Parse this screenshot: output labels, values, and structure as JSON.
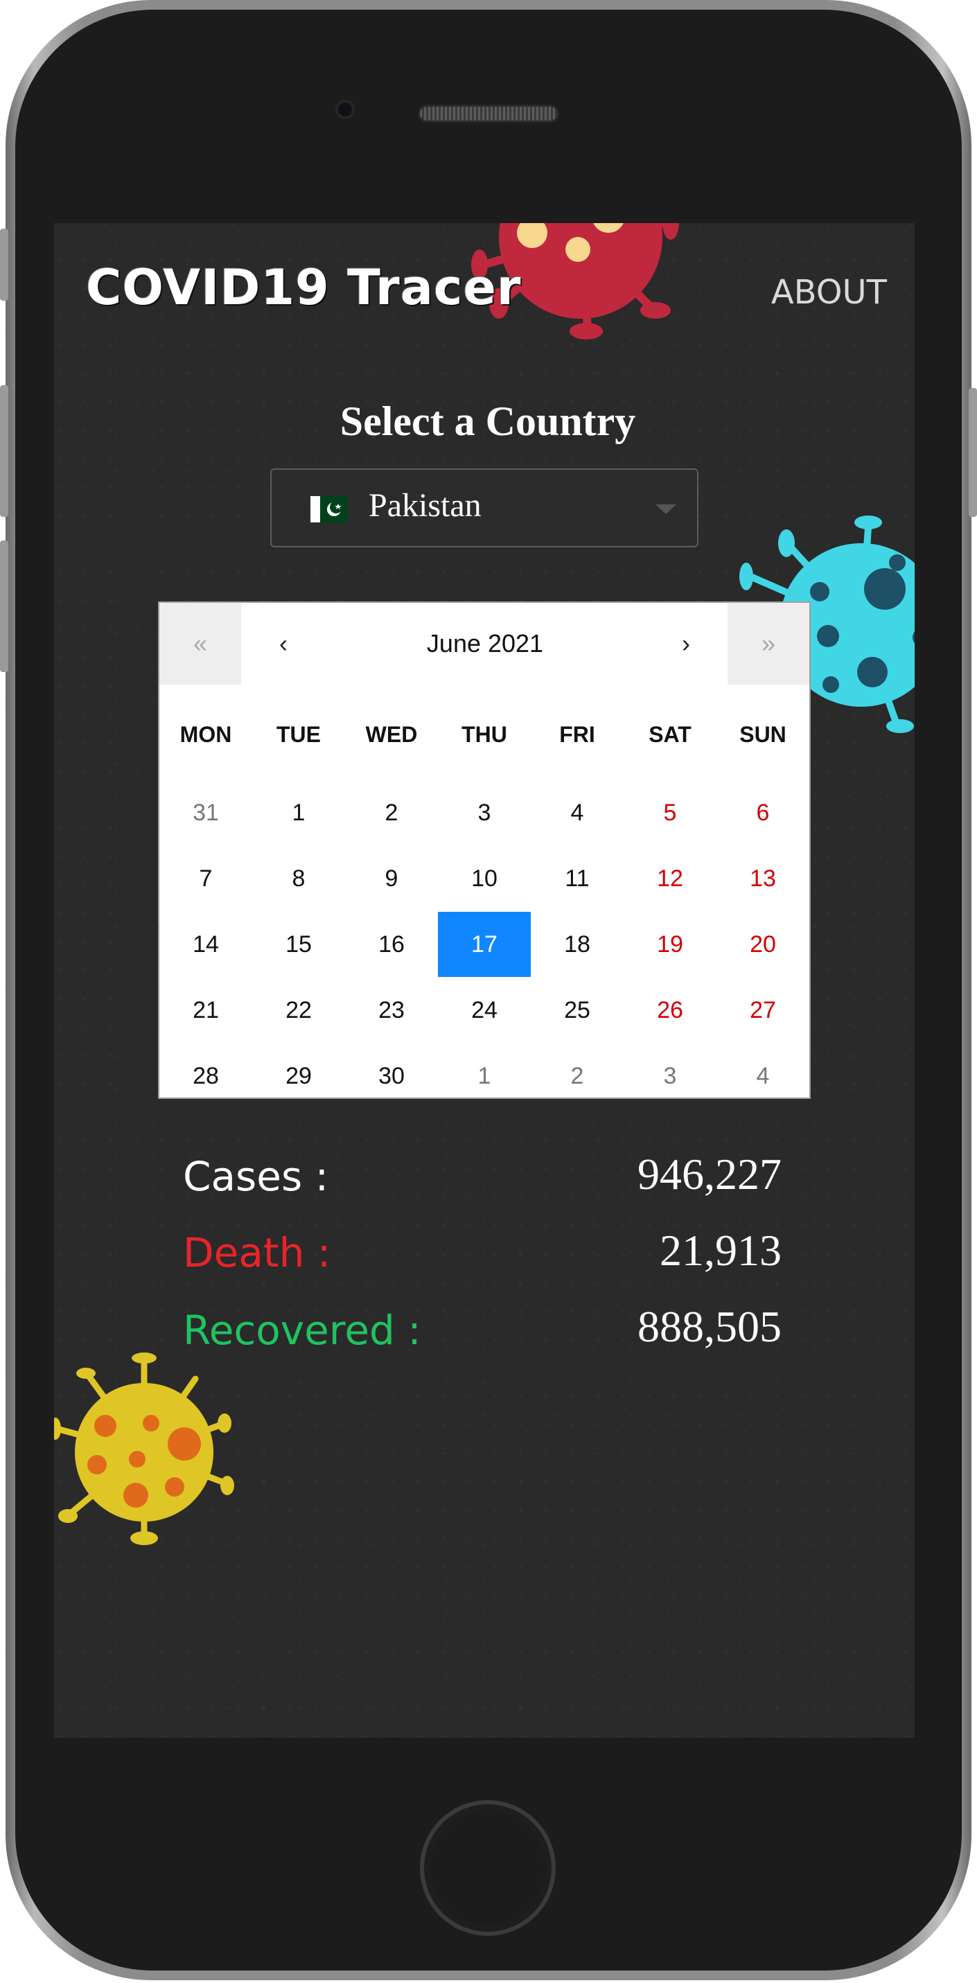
{
  "app": {
    "logo_text": "COVID19 Tracer",
    "about_label": "ABOUT"
  },
  "country_select": {
    "title": "Select a Country",
    "selected_country": "Pakistan",
    "flag_icon": "pakistan-flag-icon"
  },
  "calendar": {
    "month_label": "June 2021",
    "nav": {
      "prev_year": "«",
      "prev_month": "‹",
      "next_month": "›",
      "next_year": "»"
    },
    "weekdays": [
      "MON",
      "TUE",
      "WED",
      "THU",
      "FRI",
      "SAT",
      "SUN"
    ],
    "weeks": [
      [
        {
          "label": "31",
          "state": "muted"
        },
        {
          "label": "1",
          "state": ""
        },
        {
          "label": "2",
          "state": ""
        },
        {
          "label": "3",
          "state": ""
        },
        {
          "label": "4",
          "state": ""
        },
        {
          "label": "5",
          "state": "weekend"
        },
        {
          "label": "6",
          "state": "weekend"
        }
      ],
      [
        {
          "label": "7",
          "state": ""
        },
        {
          "label": "8",
          "state": ""
        },
        {
          "label": "9",
          "state": ""
        },
        {
          "label": "10",
          "state": ""
        },
        {
          "label": "11",
          "state": ""
        },
        {
          "label": "12",
          "state": "weekend"
        },
        {
          "label": "13",
          "state": "weekend"
        }
      ],
      [
        {
          "label": "14",
          "state": ""
        },
        {
          "label": "15",
          "state": ""
        },
        {
          "label": "16",
          "state": ""
        },
        {
          "label": "17",
          "state": "selected"
        },
        {
          "label": "18",
          "state": ""
        },
        {
          "label": "19",
          "state": "weekend"
        },
        {
          "label": "20",
          "state": "weekend"
        }
      ],
      [
        {
          "label": "21",
          "state": ""
        },
        {
          "label": "22",
          "state": ""
        },
        {
          "label": "23",
          "state": ""
        },
        {
          "label": "24",
          "state": ""
        },
        {
          "label": "25",
          "state": ""
        },
        {
          "label": "26",
          "state": "weekend"
        },
        {
          "label": "27",
          "state": "weekend"
        }
      ],
      [
        {
          "label": "28",
          "state": ""
        },
        {
          "label": "29",
          "state": ""
        },
        {
          "label": "30",
          "state": ""
        },
        {
          "label": "1",
          "state": "muted"
        },
        {
          "label": "2",
          "state": "muted"
        },
        {
          "label": "3",
          "state": "muted"
        },
        {
          "label": "4",
          "state": "muted"
        }
      ]
    ]
  },
  "stats": {
    "cases_label": "Cases :",
    "cases_value": "946,227",
    "death_label": "Death :",
    "death_value": "21,913",
    "recovered_label": "Recovered :",
    "recovered_value": "888,505"
  },
  "colors": {
    "selected_day": "#1087ff",
    "weekend_day": "#d10000",
    "death_label": "#e8242a",
    "recovered_label": "#1ec460",
    "cases_label": "#ffffff"
  }
}
